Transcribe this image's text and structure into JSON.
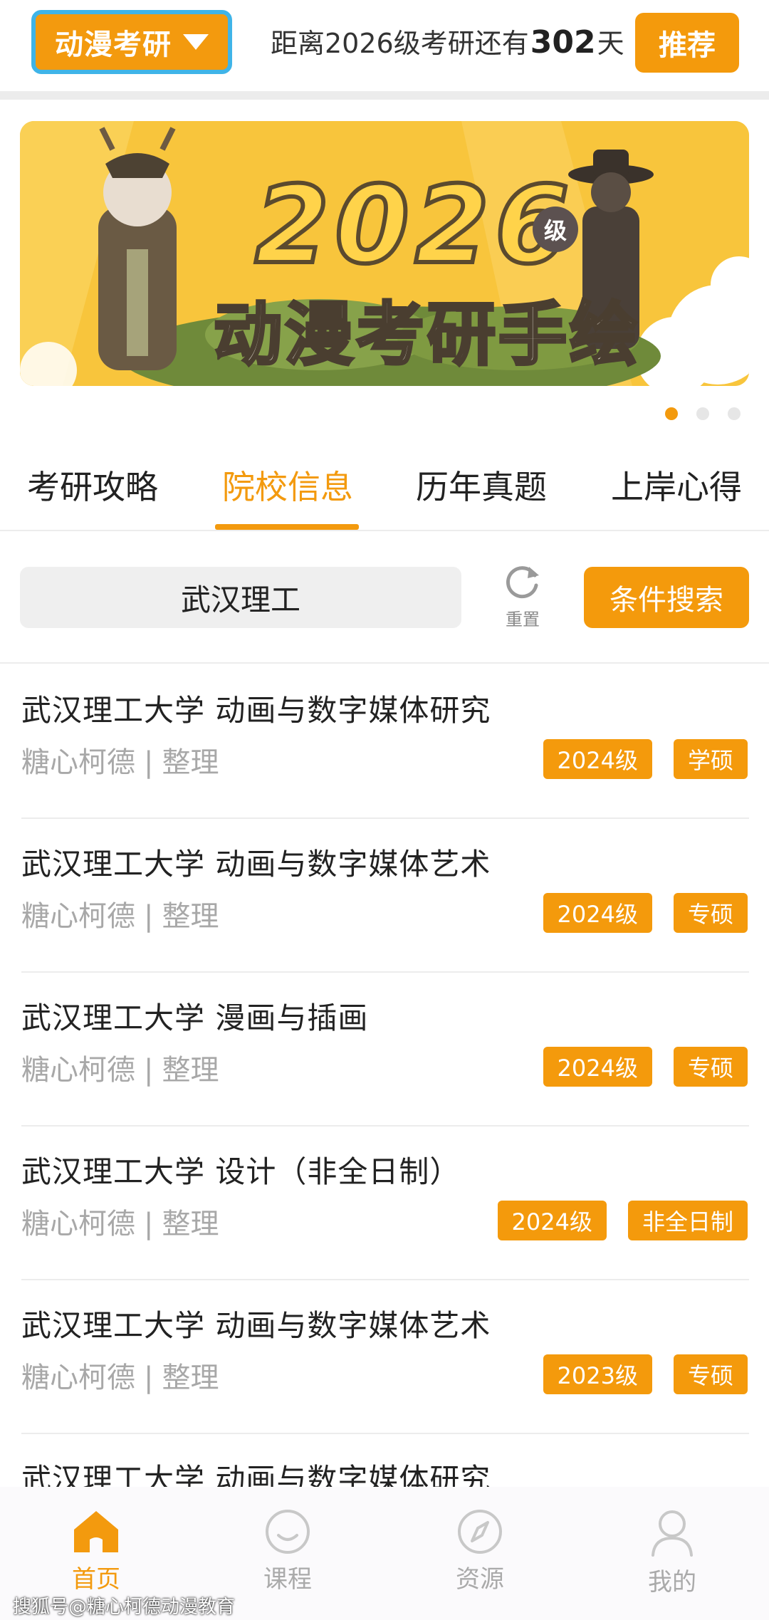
{
  "header": {
    "major_select": "动漫考研",
    "countdown_prefix": "距离2026级考研还有",
    "countdown_days": "302",
    "countdown_suffix": "天",
    "recommend_label": "推荐"
  },
  "banner": {
    "big_text": "2026",
    "level_badge": "级",
    "title": "动漫考研手绘",
    "pages": 3,
    "active_page": 1
  },
  "tabs": [
    {
      "label": "考研攻略",
      "active": false
    },
    {
      "label": "院校信息",
      "active": true
    },
    {
      "label": "历年真题",
      "active": false
    },
    {
      "label": "上岸心得",
      "active": false
    }
  ],
  "search": {
    "value": "武汉理工",
    "reset_label": "重置",
    "button_label": "条件搜索"
  },
  "list": [
    {
      "title": "武汉理工大学 动画与数字媒体研究",
      "author": "糖心柯德",
      "sep": "|",
      "role": "整理",
      "tags": [
        "2024级",
        "学硕"
      ]
    },
    {
      "title": "武汉理工大学 动画与数字媒体艺术",
      "author": "糖心柯德",
      "sep": "|",
      "role": "整理",
      "tags": [
        "2024级",
        "专硕"
      ]
    },
    {
      "title": "武汉理工大学 漫画与插画",
      "author": "糖心柯德",
      "sep": "|",
      "role": "整理",
      "tags": [
        "2024级",
        "专硕"
      ]
    },
    {
      "title": "武汉理工大学 设计（非全日制）",
      "author": "糖心柯德",
      "sep": "|",
      "role": "整理",
      "tags": [
        "2024级",
        "非全日制"
      ]
    },
    {
      "title": "武汉理工大学 动画与数字媒体艺术",
      "author": "糖心柯德",
      "sep": "|",
      "role": "整理",
      "tags": [
        "2023级",
        "专硕"
      ]
    },
    {
      "title": "武汉理工大学 动画与数字媒体研究"
    }
  ],
  "bottom_nav": [
    {
      "label": "首页",
      "icon": "home-icon",
      "active": true
    },
    {
      "label": "课程",
      "icon": "smile-icon",
      "active": false
    },
    {
      "label": "资源",
      "icon": "compass-icon",
      "active": false
    },
    {
      "label": "我的",
      "icon": "user-icon",
      "active": false
    }
  ],
  "watermark": "搜狐号@糖心柯德动漫教育",
  "colors": {
    "accent": "#f49a0c",
    "select_border": "#3fb4e8",
    "muted_text": "#a8a8a8"
  }
}
